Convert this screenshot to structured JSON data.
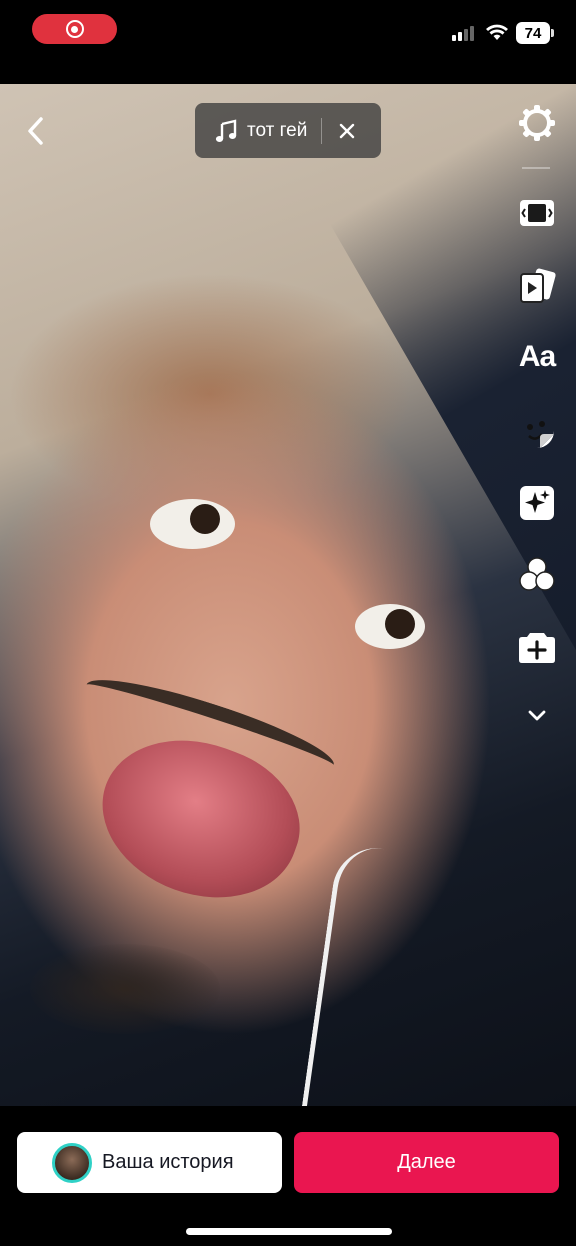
{
  "status_bar": {
    "battery_level": "74",
    "recording_indicator_color": "#e0323e"
  },
  "header": {
    "back_icon": "chevron-left-icon",
    "sound": {
      "title": "тот гей",
      "icon": "music-note-icon",
      "remove_icon": "close-icon"
    }
  },
  "toolbar": {
    "items": [
      {
        "name": "settings",
        "icon": "gear-icon"
      },
      {
        "name": "adjust-clips",
        "icon": "clips-icon"
      },
      {
        "name": "templates",
        "icon": "template-icon"
      },
      {
        "name": "text",
        "label": "Aa"
      },
      {
        "name": "stickers",
        "icon": "sticker-icon"
      },
      {
        "name": "effects",
        "icon": "sparkle-icon"
      },
      {
        "name": "filters",
        "icon": "filters-icon"
      },
      {
        "name": "add-camera",
        "icon": "camera-plus-icon"
      },
      {
        "name": "more",
        "icon": "chevron-down-icon"
      }
    ]
  },
  "bottom": {
    "story_label": "Ваша история",
    "next_label": "Далее",
    "next_color": "#ea1650",
    "avatar_ring_color": "#2fd1c6"
  }
}
